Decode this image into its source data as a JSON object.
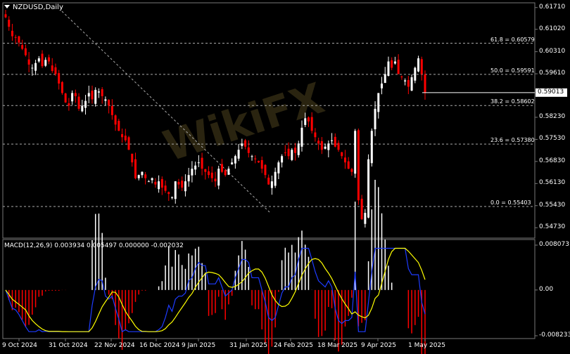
{
  "symbol_label": "NZDUSD,Daily",
  "macd_label": "MACD(12,26,9) 0.003934 0.005497 0.000000 -0.002032",
  "colors": {
    "bull": "#ffffff",
    "bear": "#ff0000",
    "grid": "#777777",
    "signal": "#ffff00",
    "macd_line": "#1e3cff",
    "watermark": "#2a2410"
  },
  "price_axis": [
    "0.61710",
    "0.61020",
    "0.60310",
    "0.59610",
    "0.58230",
    "0.57530",
    "0.56830",
    "0.56130",
    "0.55430",
    "0.54730"
  ],
  "current_price": "0.59013",
  "macd_axis": [
    "0.008073",
    "0.00",
    "-0.008233"
  ],
  "x_labels": [
    "9 Oct 2024",
    "31 Oct 2024",
    "22 Nov 2024",
    "16 Dec 2024",
    "9 Jan 2025",
    "31 Jan 2025",
    "24 Feb 2025",
    "18 Mar 2025",
    "9 Apr 2025",
    "1 May 2025"
  ],
  "fib_levels": [
    {
      "label": "61.8 = 0.60579",
      "price": 0.60579
    },
    {
      "label": "50.0 = 0.59591",
      "price": 0.59591
    },
    {
      "label": "38.2 = 0.58602",
      "price": 0.58602
    },
    {
      "label": "23.6 = 0.57380",
      "price": 0.5738
    },
    {
      "label": "0.0 = 0.55403",
      "price": 0.55403
    }
  ],
  "chart_data": {
    "type": "candlestick",
    "title": "NZDUSD,Daily",
    "ylim": [
      0.544,
      0.6186
    ],
    "close_path": [
      0.614,
      0.611,
      0.608,
      0.6075,
      0.606,
      0.604,
      0.602,
      0.599,
      0.598,
      0.5995,
      0.601,
      0.5985,
      0.6005,
      0.6,
      0.597,
      0.596,
      0.593,
      0.59,
      0.587,
      0.586,
      0.59,
      0.589,
      0.585,
      0.586,
      0.5875,
      0.59,
      0.588,
      0.591,
      0.5905,
      0.589,
      0.588,
      0.586,
      0.583,
      0.58,
      0.578,
      0.576,
      0.575,
      0.572,
      0.568,
      0.563,
      0.564,
      0.565,
      0.563,
      0.562,
      0.563,
      0.561,
      0.562,
      0.56,
      0.559,
      0.558,
      0.557,
      0.562,
      0.561,
      0.56,
      0.562,
      0.564,
      0.566,
      0.567,
      0.568,
      0.566,
      0.565,
      0.564,
      0.563,
      0.562,
      0.566,
      0.565,
      0.564,
      0.566,
      0.568,
      0.57,
      0.572,
      0.574,
      0.573,
      0.571,
      0.57,
      0.569,
      0.568,
      0.566,
      0.564,
      0.561,
      0.562,
      0.565,
      0.568,
      0.57,
      0.571,
      0.57,
      0.572,
      0.571,
      0.574,
      0.579,
      0.582,
      0.581,
      0.578,
      0.576,
      0.574,
      0.572,
      0.573,
      0.574,
      0.575,
      0.573,
      0.572,
      0.57,
      0.568,
      0.566,
      0.565,
      0.578,
      0.556,
      0.55,
      0.552,
      0.569,
      0.578,
      0.585,
      0.59,
      0.593,
      0.596,
      0.6,
      0.598,
      0.6,
      0.596,
      0.595,
      0.594,
      0.592,
      0.595,
      0.598,
      0.601,
      0.596,
      0.5901
    ],
    "macd_histogram_range": [
      -0.008233,
      0.008073
    ],
    "current_price": 0.59013
  }
}
